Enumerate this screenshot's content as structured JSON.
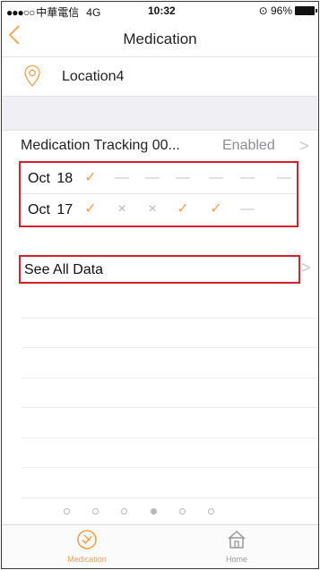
{
  "status_bar": {
    "signal_dots": "●●●○○",
    "carrier": "中華電信",
    "network": "4G",
    "time": "10:32",
    "battery": "96%",
    "battery_prefix": "⊙"
  },
  "nav": {
    "back_icon": "chevron-left-icon",
    "title": "Medication"
  },
  "location": {
    "icon": "location-pin-icon",
    "label": "Location4"
  },
  "tracking": {
    "name": "Medication Tracking 00...",
    "status": "Enabled",
    "chevron": ">"
  },
  "days": [
    {
      "date": "Oct  18",
      "marks": [
        "check",
        "dash",
        "dash",
        "dash",
        "dash",
        "dash",
        "dash"
      ]
    },
    {
      "date": "Oct  17",
      "marks": [
        "check",
        "cross",
        "cross",
        "check",
        "check",
        "dash"
      ]
    }
  ],
  "mark_glyphs": {
    "check": "✓",
    "cross": "×",
    "dash": "—"
  },
  "see_all": {
    "label": "See All Data",
    "chevron": ">"
  },
  "pager": {
    "count": 6,
    "active_index": 3
  },
  "tabs": [
    {
      "label": "Medication",
      "icon": "pill-badge-icon",
      "active": true
    },
    {
      "label": "Home",
      "icon": "home-icon",
      "active": false
    }
  ],
  "colors": {
    "accent": "#f0a050",
    "highlight_border": "#d9202a",
    "muted": "#8e8e93"
  }
}
